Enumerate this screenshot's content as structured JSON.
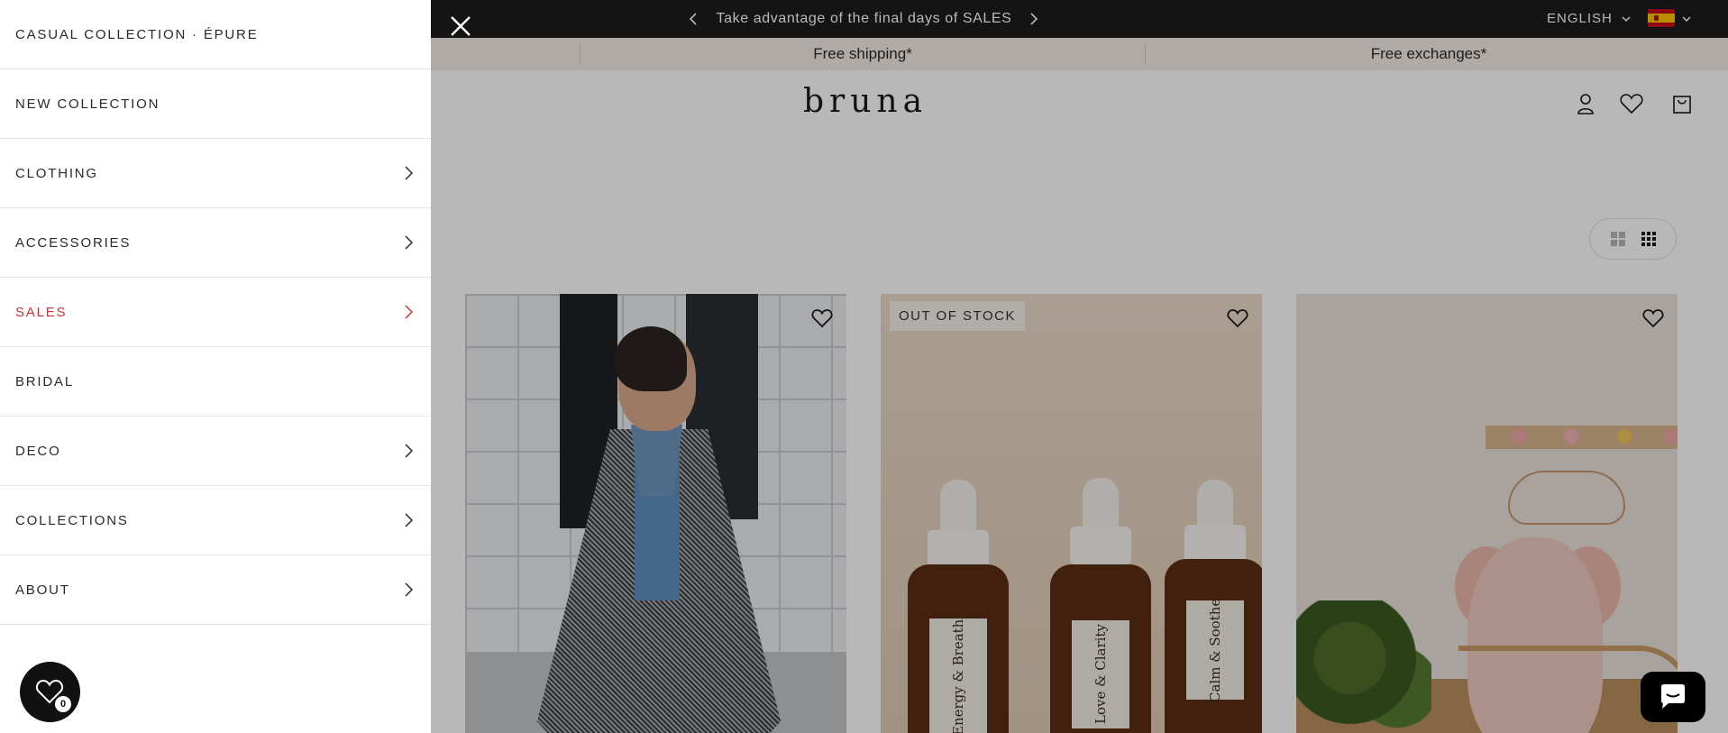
{
  "drawer": {
    "items": [
      {
        "label": "CASUAL COLLECTION · ÉPURE",
        "has_submenu": false
      },
      {
        "label": "NEW COLLECTION",
        "has_submenu": false
      },
      {
        "label": "CLOTHING",
        "has_submenu": true
      },
      {
        "label": "ACCESSORIES",
        "has_submenu": true
      },
      {
        "label": "SALES",
        "has_submenu": true,
        "color": "#c4373a"
      },
      {
        "label": "BRIDAL",
        "has_submenu": false
      },
      {
        "label": "DECO",
        "has_submenu": true
      },
      {
        "label": "COLLECTIONS",
        "has_submenu": true
      },
      {
        "label": "ABOUT",
        "has_submenu": true
      }
    ],
    "wishlist_count": "0"
  },
  "announcement": {
    "text": "Take advantage of the final days of SALES",
    "language": "ENGLISH",
    "flag": "spain-flag-icon"
  },
  "promo_bar": {
    "items": [
      "Free shipping*",
      "Free exchanges*"
    ]
  },
  "header": {
    "logo": "bruna",
    "icons": [
      "account-icon",
      "wishlist-icon",
      "cart-icon"
    ]
  },
  "products": [
    {
      "name": "houndstooth-coat",
      "badge": ""
    },
    {
      "name": "essential-oil-bottles",
      "badge": "OUT OF STOCK",
      "bottle_labels": [
        "Energy & Breath",
        "Love & Clarity",
        "Calm & Soothe"
      ]
    },
    {
      "name": "nursery-decor",
      "badge": ""
    }
  ],
  "colors": {
    "sales_red": "#c4373a",
    "announcement_bg": "#1c1c1c",
    "promo_bg": "#f3ece6"
  }
}
